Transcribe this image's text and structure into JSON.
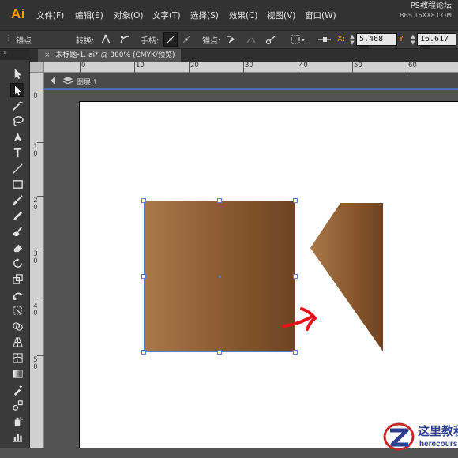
{
  "app": {
    "logo": "Ai"
  },
  "menu": [
    "文件(F)",
    "编辑(E)",
    "对象(O)",
    "文字(T)",
    "选择(S)",
    "效果(C)",
    "视图(V)",
    "窗口(W)"
  ],
  "watermark_top": {
    "line1": "PS教程论坛",
    "line2": "BBS.16XX8.COM"
  },
  "control_bar": {
    "title": "锚点",
    "convert_label": "转换:",
    "handles_label": "手柄:",
    "anchor_label": "锚点:",
    "x_label": "X:",
    "x_value": "5.468 mm",
    "y_label": "Y:",
    "y_value": "16.617 mm"
  },
  "document": {
    "tab_title": "未标题-1. ai* @ 300% (CMYK/预览)",
    "close": "×"
  },
  "layer": {
    "name": "图层 1"
  },
  "ruler": {
    "h_labels": [
      "0",
      "10",
      "20",
      "30",
      "40",
      "50",
      "60"
    ],
    "v_labels": [
      "0",
      "1 0",
      "2 0",
      "3 0",
      "4 0",
      "5 0"
    ]
  },
  "colors": {
    "accent": "#ff9a00",
    "selection": "#5b7bd5",
    "gradient_light": "#a9794a",
    "gradient_dark": "#6f4321",
    "arrow": "#e8121b"
  },
  "tools": [
    "selection-tool",
    "direct-selection-tool",
    "magic-wand-tool",
    "lasso-tool",
    "pen-tool",
    "type-tool",
    "line-tool",
    "rectangle-tool",
    "paintbrush-tool",
    "pencil-tool",
    "blob-brush-tool",
    "eraser-tool",
    "rotate-tool",
    "scale-tool",
    "warp-tool",
    "free-transform-tool",
    "shape-builder-tool",
    "perspective-grid-tool",
    "mesh-tool",
    "gradient-tool",
    "eyedropper-tool",
    "blend-tool",
    "symbol-sprayer-tool",
    "column-graph-tool"
  ],
  "site_logo": {
    "name": "这里教程网",
    "url": "herecours.com"
  }
}
